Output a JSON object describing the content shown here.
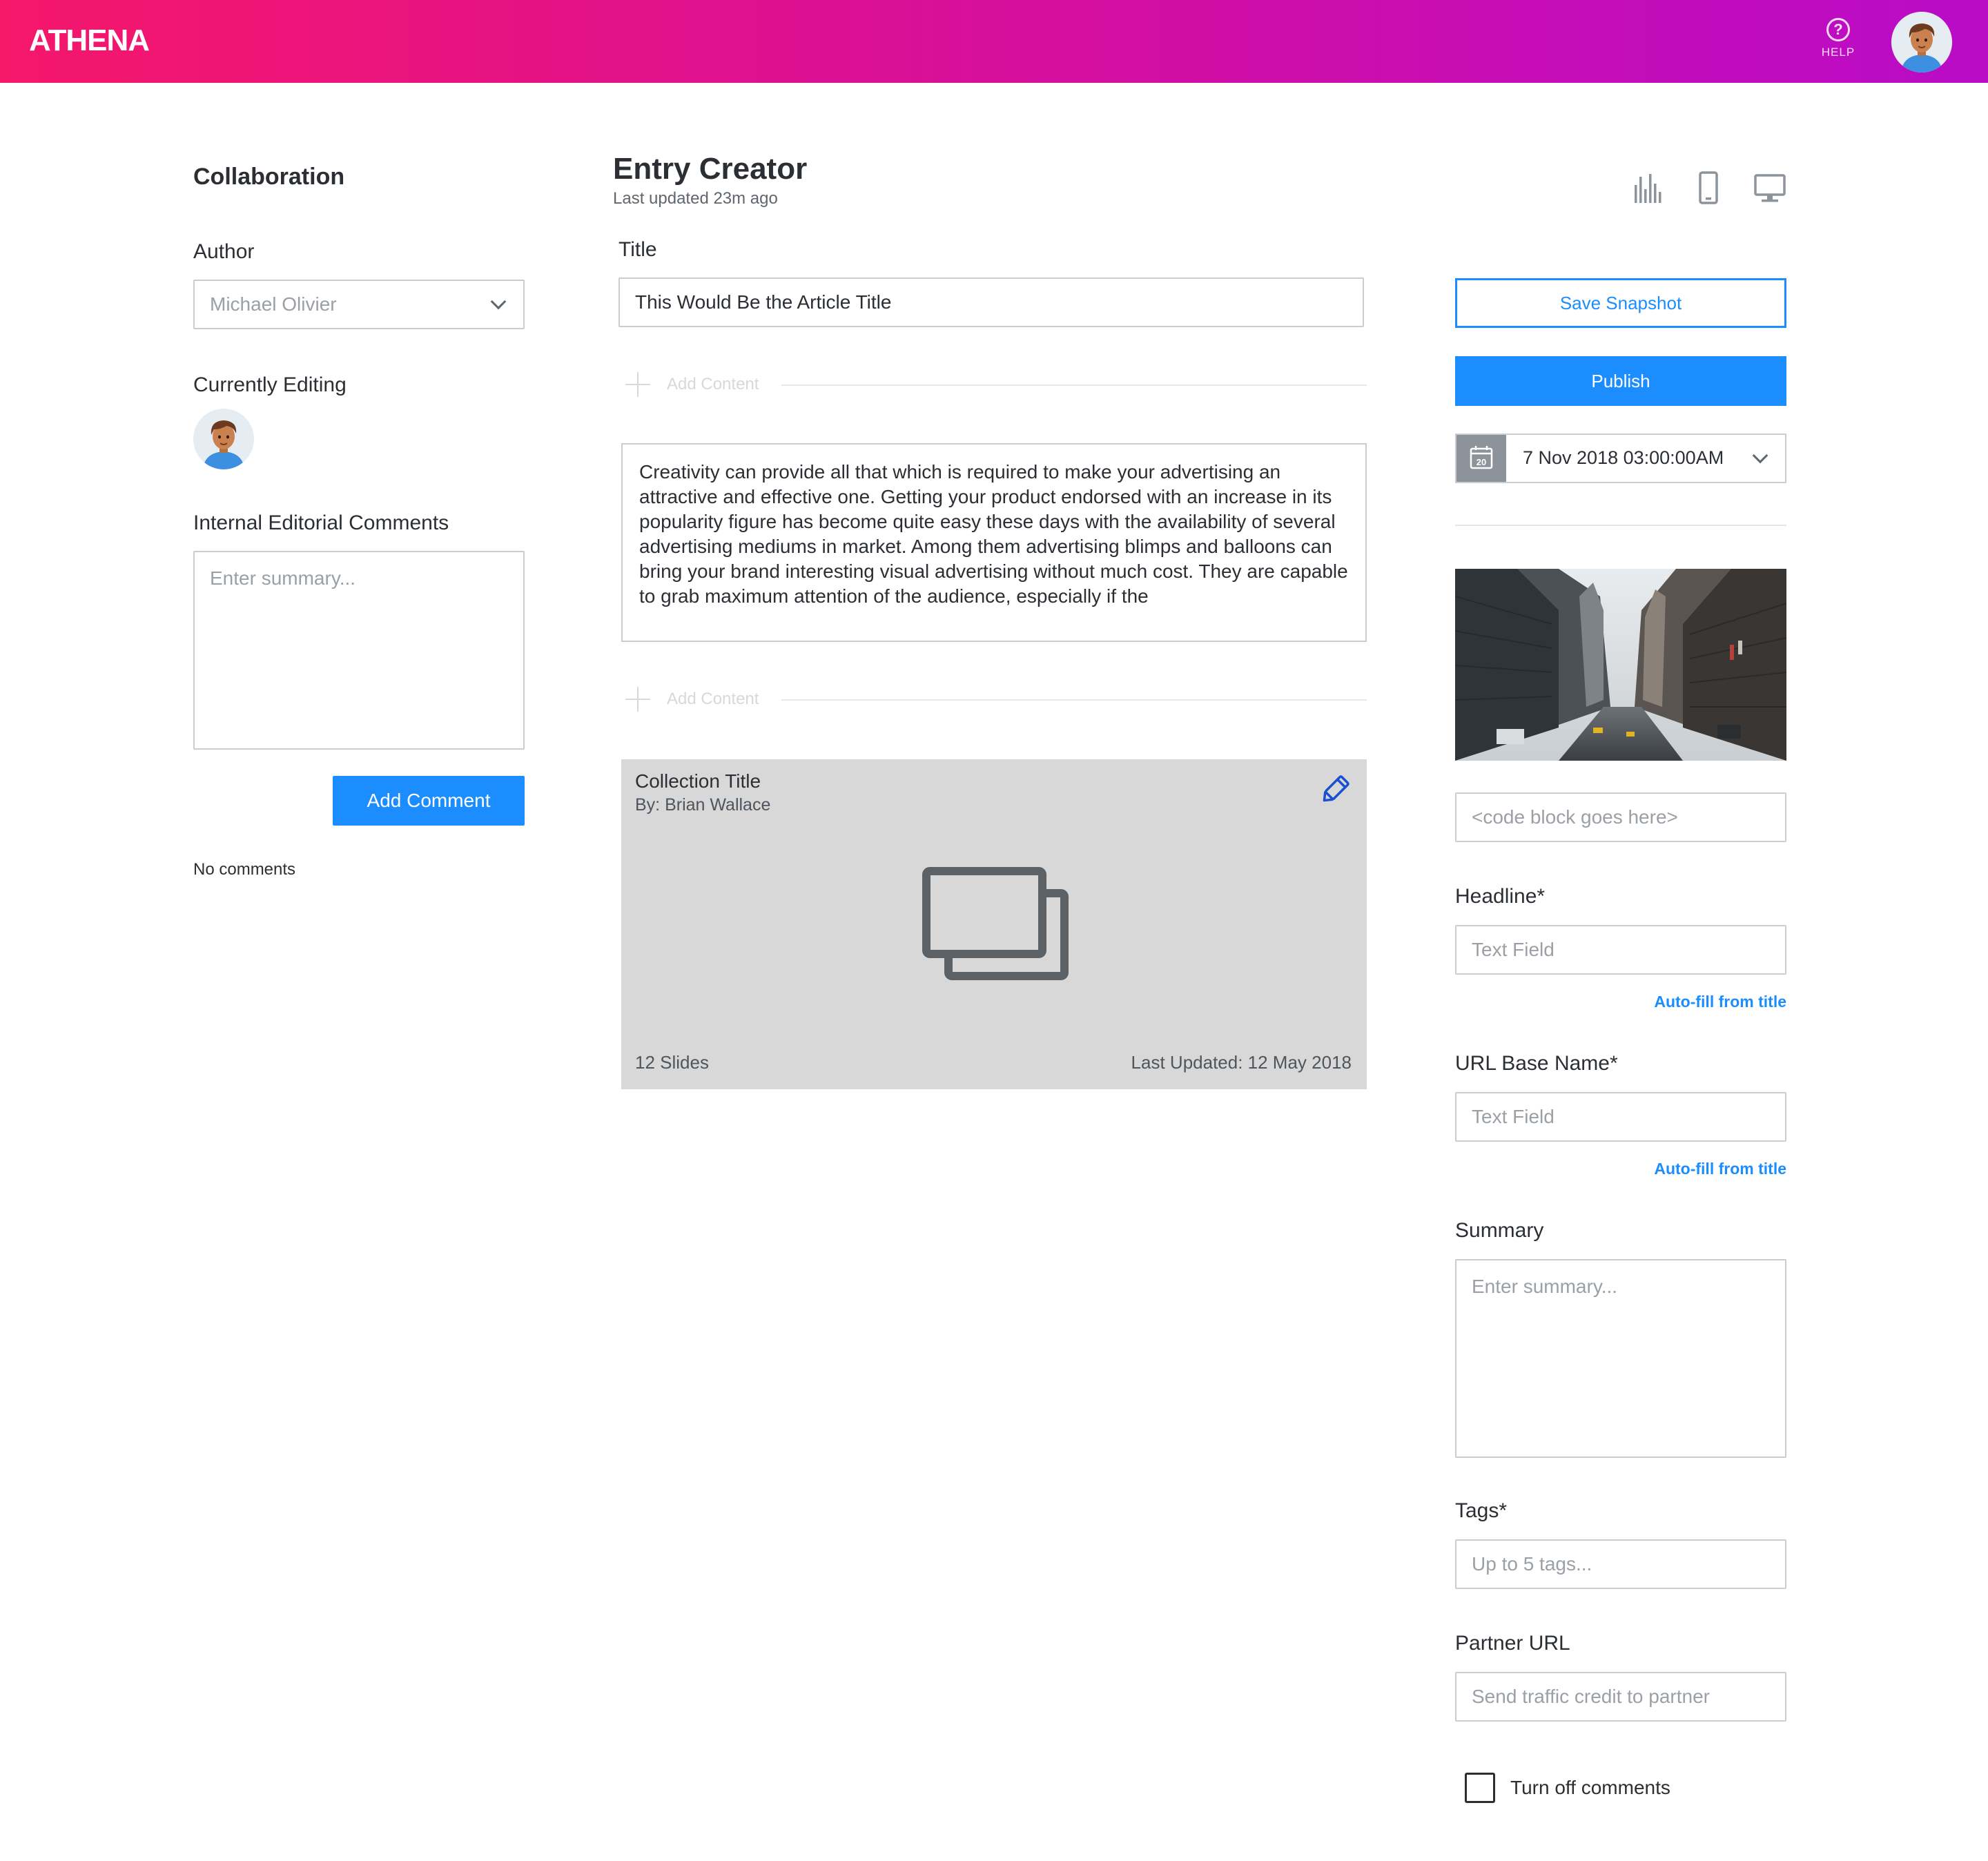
{
  "header": {
    "logo": "ATHENA",
    "help_label": "HELP",
    "help_icon": "?",
    "gradient": [
      "#f5176a",
      "#b90cc7"
    ]
  },
  "collaboration": {
    "title": "Collaboration",
    "author_label": "Author",
    "author_value": "Michael Olivier",
    "currently_editing_label": "Currently Editing",
    "comments_label": "Internal Editorial Comments",
    "comments_placeholder": "Enter summary...",
    "add_comment_button": "Add Comment",
    "no_comments": "No comments"
  },
  "editor": {
    "title": "Entry Creator",
    "last_updated": "Last updated 23m ago",
    "title_label": "Title",
    "title_value": "This Would Be the Article Title",
    "add_content_label": "Add Content",
    "body_text": "Creativity can provide all that which is required to make your advertising an attractive and effective one. Getting your product endorsed with an increase in its popularity figure has become quite easy these days with the availability of several advertising mediums in market. Among them advertising blimps and balloons can bring your brand interesting visual advertising without much cost. They are capable to grab maximum attention of the audience, especially if the",
    "collection": {
      "title": "Collection Title",
      "by": "By: Brian Wallace",
      "slides": "12 Slides",
      "last_updated": "Last Updated: 12 May 2018"
    }
  },
  "sidebar": {
    "view_icons": [
      "analytics-icon",
      "mobile-view-icon",
      "desktop-view-icon"
    ],
    "save_snapshot_button": "Save Snapshot",
    "publish_button": "Publish",
    "calendar_day": "20",
    "publish_date": "7 Nov 2018 03:00:00AM",
    "code_placeholder": "<code block goes here>",
    "headline_label": "Headline*",
    "headline_placeholder": "Text Field",
    "autofill_label": "Auto-fill from title",
    "url_label": "URL Base Name*",
    "url_placeholder": "Text Field",
    "summary_label": "Summary",
    "summary_placeholder": "Enter summary...",
    "tags_label": "Tags*",
    "tags_placeholder": "Up to 5 tags...",
    "partner_label": "Partner URL",
    "partner_placeholder": "Send traffic credit to partner",
    "turn_off_comments_label": "Turn off comments",
    "turn_off_comments_checked": false
  },
  "colors": {
    "accent": "#1b8dff",
    "text": "#2b2f33",
    "placeholder": "#9aa0a6",
    "border": "#c9ccd0",
    "collection_bg": "#d8d8d8"
  }
}
